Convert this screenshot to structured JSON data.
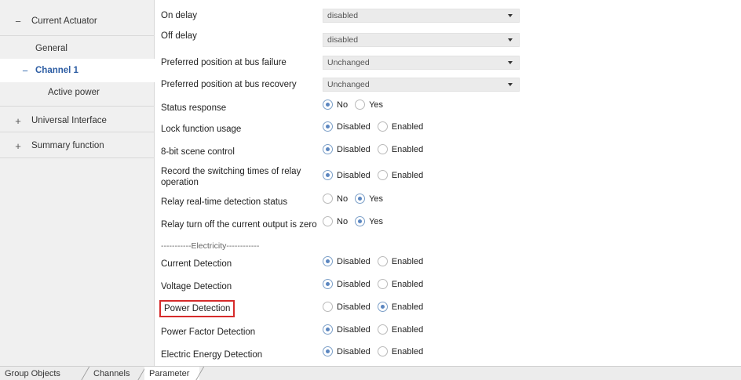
{
  "sidebar": {
    "items": [
      {
        "toggle": "−",
        "label": "Current Actuator"
      },
      {
        "toggle": "",
        "label": "General"
      },
      {
        "toggle": "−",
        "label": "Channel 1"
      },
      {
        "toggle": "",
        "label": "Active power"
      },
      {
        "toggle": "+",
        "label": "Universal Interface"
      },
      {
        "toggle": "+",
        "label": "Summary function"
      }
    ]
  },
  "params": [
    {
      "label": "On delay",
      "value": "disabled"
    },
    {
      "label": "Off delay",
      "value": "disabled"
    },
    {
      "label": "Preferred position at bus failure",
      "value": "Unchanged"
    },
    {
      "label": "Preferred position at bus recovery",
      "value": "Unchanged"
    },
    {
      "label": "Status response",
      "opt1": "No",
      "opt2": "Yes",
      "selected": "No"
    },
    {
      "label": "Lock function usage",
      "opt1": "Disabled",
      "opt2": "Enabled",
      "selected": "Disabled"
    },
    {
      "label": "8-bit scene control",
      "opt1": "Disabled",
      "opt2": "Enabled",
      "selected": "Disabled"
    },
    {
      "label1": "Record the switching times of relay",
      "label2": "operation",
      "opt1": "Disabled",
      "opt2": "Enabled",
      "selected": "Disabled"
    },
    {
      "label": "Relay real-time detection status",
      "opt1": "No",
      "opt2": "Yes",
      "selected": "Yes"
    },
    {
      "label": "Relay turn off the current output is zero",
      "opt1": "No",
      "opt2": "Yes",
      "selected": "Yes"
    },
    {
      "label": "-----------Electricity------------"
    },
    {
      "label": "Current Detection",
      "opt1": "Disabled",
      "opt2": "Enabled",
      "selected": "Disabled"
    },
    {
      "label": "Voltage Detection",
      "opt1": "Disabled",
      "opt2": "Enabled",
      "selected": "Disabled"
    },
    {
      "label": "Power Detection",
      "opt1": "Disabled",
      "opt2": "Enabled",
      "selected": "Enabled"
    },
    {
      "label": "Power Factor Detection",
      "opt1": "Disabled",
      "opt2": "Enabled",
      "selected": "Disabled"
    },
    {
      "label": "Electric Energy Detection",
      "opt1": "Disabled",
      "opt2": "Enabled",
      "selected": "Disabled"
    }
  ],
  "tabs": [
    {
      "label": "Group Objects"
    },
    {
      "label": "Channels"
    },
    {
      "label": "Parameter",
      "active": true
    }
  ],
  "colors": {
    "highlight_box": "#d62b2b",
    "radio_selected": "#5b86c0"
  }
}
